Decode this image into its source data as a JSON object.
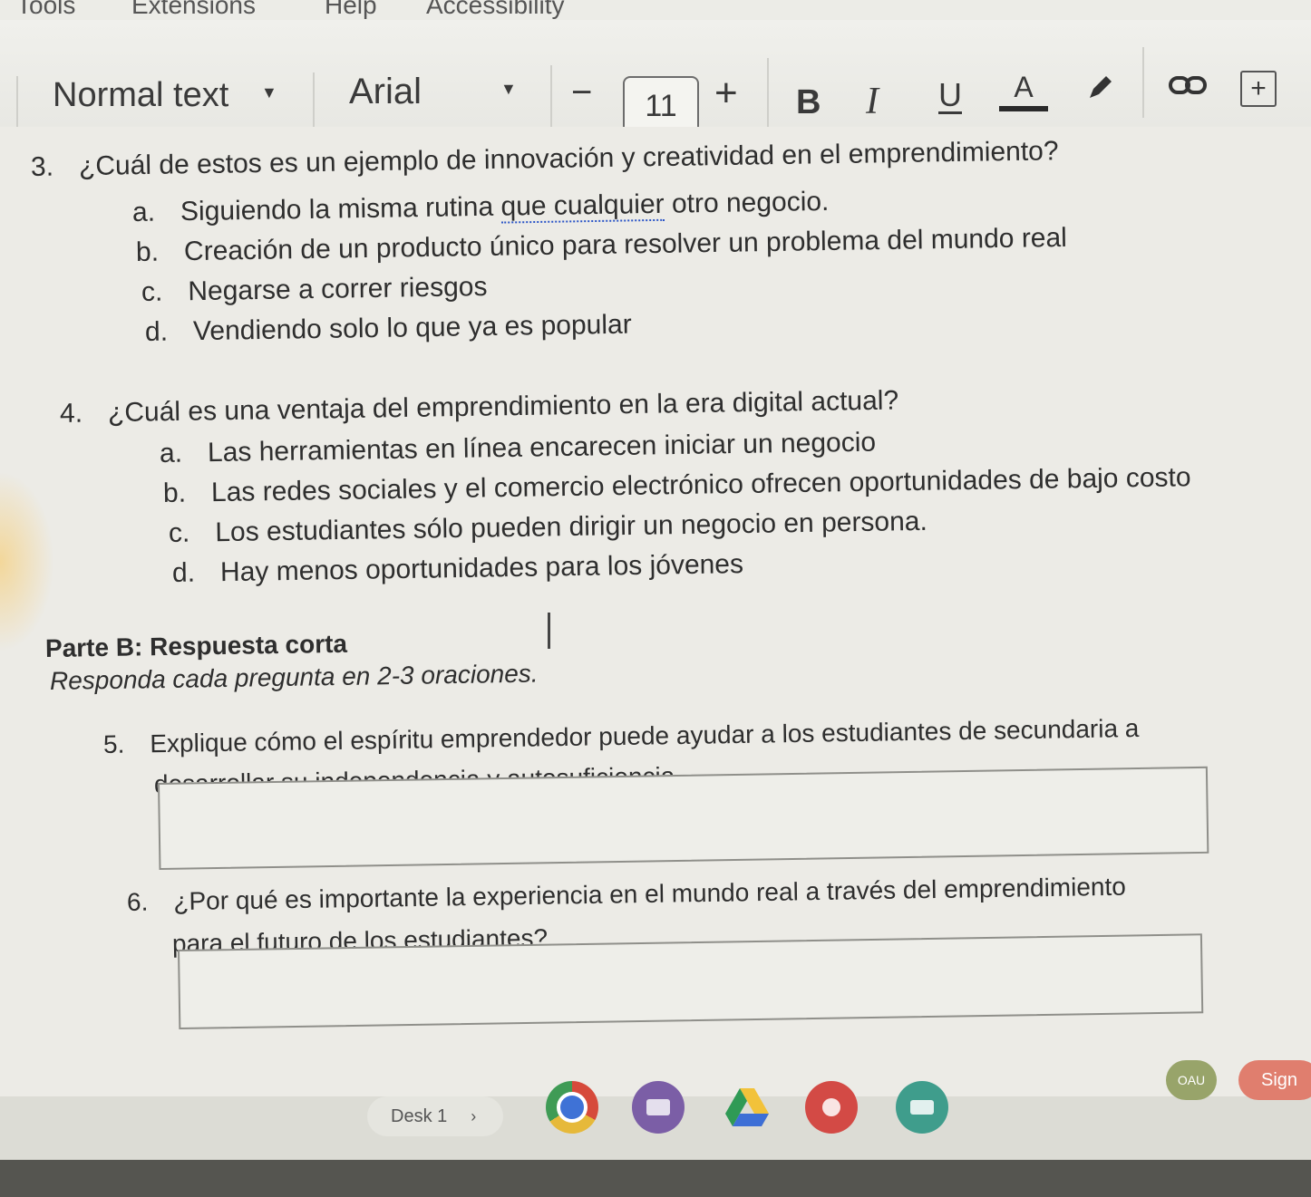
{
  "menu": {
    "items": [
      "Tools",
      "Extensions",
      "Help",
      "Accessibility"
    ]
  },
  "toolbar": {
    "style": "Normal text",
    "font": "Arial",
    "decrease": "−",
    "size": "11",
    "increase": "+",
    "bold": "B",
    "italic": "I",
    "underline": "U",
    "text_color": "A",
    "icons": [
      "chevron-down-icon",
      "pencil-icon",
      "link-icon",
      "add-comment-icon"
    ]
  },
  "questions": [
    {
      "number": "3.",
      "text": "¿Cuál de estos es un ejemplo de innovación y creatividad en el emprendimiento?",
      "options": [
        {
          "letter": "a.",
          "pre": "Siguiendo la misma rutina ",
          "flagged": "que cualquier",
          "post": " otro negocio."
        },
        {
          "letter": "b.",
          "text": "Creación de un producto único para resolver un problema del mundo real"
        },
        {
          "letter": "c.",
          "text": "Negarse a correr riesgos"
        },
        {
          "letter": "d.",
          "text": "Vendiendo solo lo que ya es popular"
        }
      ]
    },
    {
      "number": "4.",
      "text": "¿Cuál es una ventaja del emprendimiento en la era digital actual?",
      "options": [
        {
          "letter": "a.",
          "text": "Las herramientas en línea encarecen iniciar un negocio"
        },
        {
          "letter": "b.",
          "text": "Las redes sociales y el comercio electrónico ofrecen oportunidades de bajo costo"
        },
        {
          "letter": "c.",
          "text": "Los estudiantes sólo pueden dirigir un negocio en persona."
        },
        {
          "letter": "d.",
          "text": "Hay menos oportunidades para los jóvenes"
        }
      ]
    }
  ],
  "part_b": {
    "title": "Parte B: Respuesta corta",
    "instructions": "Responda cada pregunta en 2-3 oraciones."
  },
  "short_answers": [
    {
      "number": "5.",
      "line1": "Explique cómo el espíritu emprendedor puede ayudar a los estudiantes de secundaria a",
      "line2": "desarrollar su independencia y autosuficiencia."
    },
    {
      "number": "6.",
      "line1": "¿Por qué es importante la experiencia en el mundo real a través del emprendimiento",
      "line2": "para el futuro de los estudiantes?"
    }
  ],
  "shelf": {
    "desk": "Desk 1",
    "chevron": "›",
    "apps": [
      "chrome-icon",
      "app-icon",
      "drive-icon",
      "app-icon",
      "app-icon"
    ],
    "badge": "OAU",
    "sign": "Sign"
  }
}
